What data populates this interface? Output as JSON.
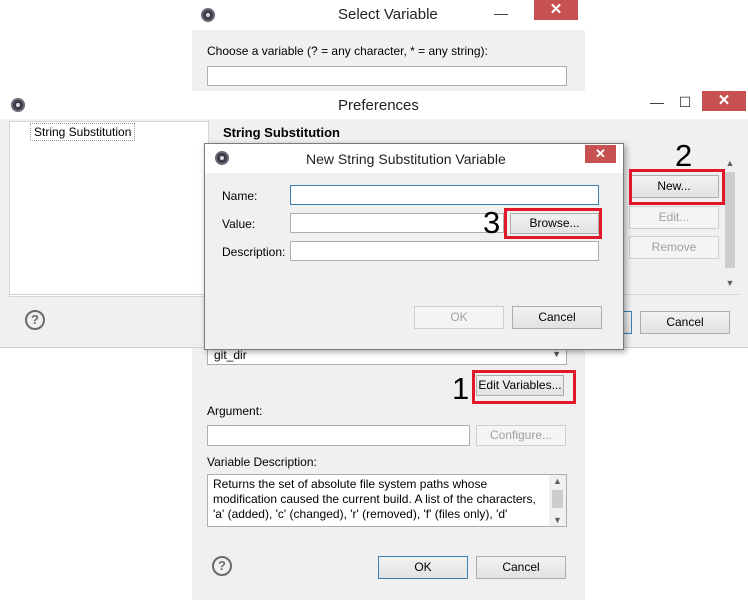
{
  "select_variable": {
    "title": "Select Variable",
    "prompt": "Choose a variable (? = any character, * = any string):",
    "filter_value": "",
    "selected_variable": "git_dir",
    "edit_variables_label": "Edit Variables...",
    "argument_label": "Argument:",
    "argument_value": "",
    "configure_label": "Configure...",
    "variable_description_label": "Variable Description:",
    "description_text": "Returns the set of absolute file system paths whose modification caused the current build.  A list of the characters, 'a' (added), 'c' (changed), 'r' (removed), 'f' (files only), 'd'",
    "ok_label": "OK",
    "cancel_label": "Cancel",
    "minimize_glyph": "—",
    "close_glyph": "✕"
  },
  "preferences": {
    "title": "Preferences",
    "tree_item": "String Substitution",
    "page_title": "String Substitution",
    "new_label": "New...",
    "edit_label": "Edit...",
    "remove_label": "Remove",
    "cancel_label": "Cancel",
    "minimize_glyph": "—",
    "maximize_glyph": "☐",
    "close_glyph": "✕"
  },
  "new_variable_dialog": {
    "title": "New String Substitution Variable",
    "name_label": "Name:",
    "name_value": "",
    "value_label": "Value:",
    "value_value": "",
    "browse_label": "Browse...",
    "description_label": "Description:",
    "description_value": "",
    "ok_label": "OK",
    "cancel_label": "Cancel",
    "close_glyph": "✕"
  },
  "annotations": {
    "step1": "1",
    "step2": "2",
    "step3": "3",
    "color": "#e0182a"
  },
  "help_glyph": "?"
}
